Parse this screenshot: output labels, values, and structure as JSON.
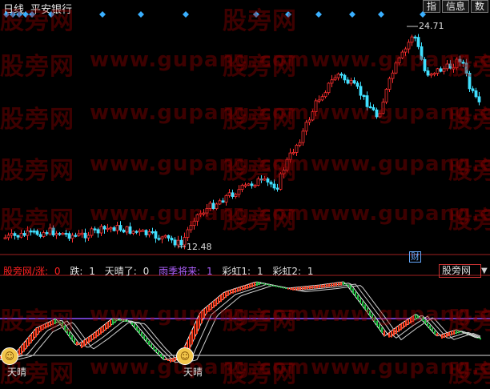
{
  "title": {
    "chart_type": "日线",
    "stock_name": "平安银行"
  },
  "top_buttons": [
    "指",
    "信息",
    "数"
  ],
  "watermarks": {
    "brand": "股旁网",
    "url": "www.gupang.com"
  },
  "price_labels": {
    "high": "24.71",
    "low": "12.48"
  },
  "cai_label": "财",
  "indicator_legend": {
    "item1": {
      "label": "股旁网/涨:",
      "value": "0",
      "color": "#ff2020"
    },
    "item2": {
      "label": "跌:",
      "value": "1",
      "color": "#e0e0e0"
    },
    "item3": {
      "label": "天晴了:",
      "value": "0",
      "color": "#e0e0e0"
    },
    "item4": {
      "label": "雨季将来:",
      "value": "1",
      "color": "#b060ff"
    },
    "item5": {
      "label": "彩虹1:",
      "value": "1",
      "color": "#e0e0e0"
    },
    "item6": {
      "label": "彩虹2:",
      "value": "1",
      "color": "#e0e0e0"
    }
  },
  "dropdown_value": "股旁网",
  "signal_labels": {
    "left": "天晴",
    "right": "天晴"
  },
  "icons": {
    "signal_badge": "smiley-sun-icon",
    "dropdown": "triangle-down-icon",
    "top_marker": "diamond-icon"
  },
  "colors": {
    "up": "#ff3030",
    "down": "#40e0ff",
    "marker": "#3ab0ff",
    "line_purple": "#9050ff"
  }
}
